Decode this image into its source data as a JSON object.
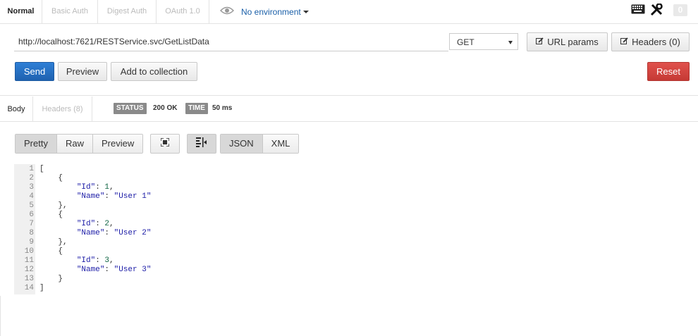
{
  "auth_tabs": [
    "Normal",
    "Basic Auth",
    "Digest Auth",
    "OAuth 1.0"
  ],
  "environment": "No environment",
  "top_badge": "0",
  "request": {
    "url": "http://localhost:7621/RESTService.svc/GetListData",
    "method": "GET",
    "url_params_label": "URL params",
    "headers_label": "Headers (0)",
    "send_label": "Send",
    "preview_label": "Preview",
    "add_collection_label": "Add to collection",
    "reset_label": "Reset"
  },
  "response": {
    "tabs": [
      "Body",
      "Headers (8)"
    ],
    "status_label": "STATUS",
    "status_value": "200 OK",
    "time_label": "TIME",
    "time_value": "50 ms",
    "view_modes": [
      "Pretty",
      "Raw",
      "Preview"
    ],
    "formats": [
      "JSON",
      "XML"
    ],
    "lines": [
      {
        "num": "1",
        "text": "["
      },
      {
        "num": "2",
        "text": "    {"
      },
      {
        "num": "3",
        "key": "\"Id\"",
        "val": "1",
        "val_type": "num",
        "end": ","
      },
      {
        "num": "4",
        "key": "\"Name\"",
        "val": "\"User 1\"",
        "val_type": "str",
        "end": ""
      },
      {
        "num": "5",
        "text": "    },"
      },
      {
        "num": "6",
        "text": "    {"
      },
      {
        "num": "7",
        "key": "\"Id\"",
        "val": "2",
        "val_type": "num",
        "end": ","
      },
      {
        "num": "8",
        "key": "\"Name\"",
        "val": "\"User 2\"",
        "val_type": "str",
        "end": ""
      },
      {
        "num": "9",
        "text": "    },"
      },
      {
        "num": "10",
        "text": "    {"
      },
      {
        "num": "11",
        "key": "\"Id\"",
        "val": "3",
        "val_type": "num",
        "end": ","
      },
      {
        "num": "12",
        "key": "\"Name\"",
        "val": "\"User 3\"",
        "val_type": "str",
        "end": ""
      },
      {
        "num": "13",
        "text": "    }"
      },
      {
        "num": "14",
        "text": "]"
      }
    ]
  },
  "colors": {
    "send": "#1f62b0",
    "reset": "#c53a35",
    "env": "#1a5fa8"
  }
}
